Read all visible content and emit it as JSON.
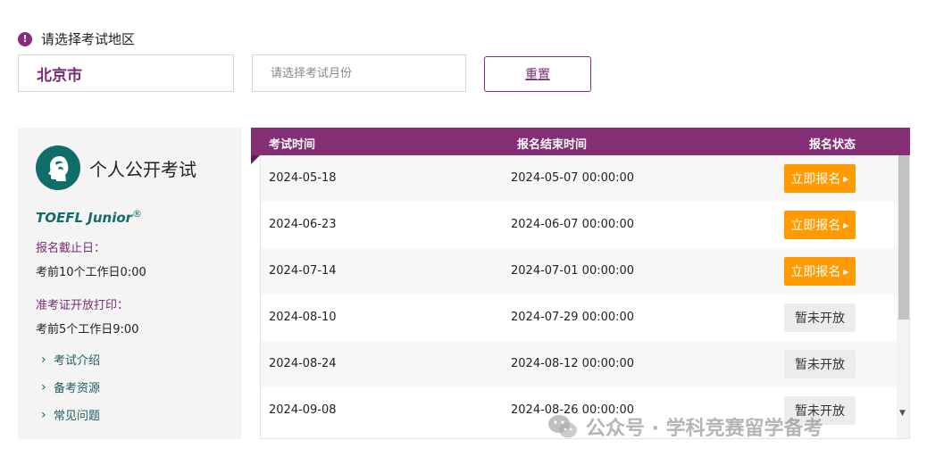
{
  "filter": {
    "region_label": "请选择考试地区",
    "region_value": "北京市",
    "month_placeholder": "请选择考试月份",
    "reset_label": "重置"
  },
  "sidebar": {
    "title": "个人公开考试",
    "brand": "TOEFL Junior",
    "brand_mark": "®",
    "deadline_label": "报名截止日：",
    "deadline_value": "考前10个工作日0:00",
    "admission_label": "准考证开放打印：",
    "admission_value": "考前5个工作日9:00",
    "links": [
      "考试介绍",
      "备考资源",
      "常见问题"
    ]
  },
  "table": {
    "headers": [
      "考试时间",
      "报名结束时间",
      "报名状态"
    ],
    "rows": [
      {
        "date": "2024-05-18",
        "end": "2024-05-07 00:00:00",
        "status": "立即报名",
        "open": true
      },
      {
        "date": "2024-06-23",
        "end": "2024-06-07 00:00:00",
        "status": "立即报名",
        "open": true
      },
      {
        "date": "2024-07-14",
        "end": "2024-07-01 00:00:00",
        "status": "立即报名",
        "open": true
      },
      {
        "date": "2024-08-10",
        "end": "2024-07-29 00:00:00",
        "status": "暂未开放",
        "open": false
      },
      {
        "date": "2024-08-24",
        "end": "2024-08-12 00:00:00",
        "status": "暂未开放",
        "open": false
      },
      {
        "date": "2024-09-08",
        "end": "2024-08-26 00:00:00",
        "status": "暂未开放",
        "open": false
      }
    ]
  },
  "watermark": {
    "text": "公众号 · 学科竞赛留学备考"
  },
  "colors": {
    "brand_purple": "#842e75",
    "teal": "#0f6e6a",
    "apply_orange": "#ff9a00"
  }
}
